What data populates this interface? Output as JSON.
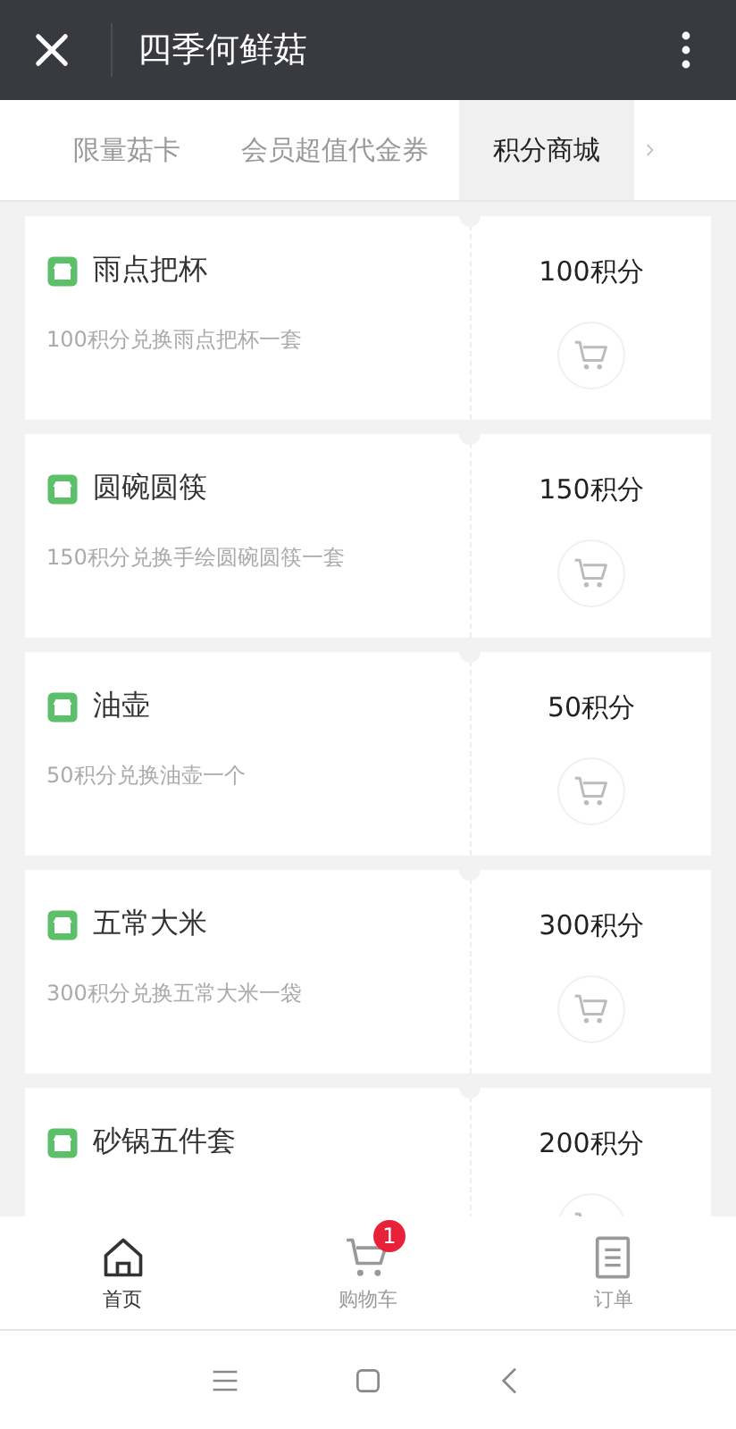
{
  "header": {
    "title": "四季何鲜菇"
  },
  "tabs": [
    {
      "label": "限量菇卡",
      "selected": false
    },
    {
      "label": "会员超值代金券",
      "selected": false
    },
    {
      "label": "积分商城",
      "selected": true
    }
  ],
  "products": [
    {
      "name": "雨点把杯",
      "description": "100积分兑换雨点把杯一套",
      "points": "100积分"
    },
    {
      "name": "圆碗圆筷",
      "description": "150积分兑换手绘圆碗圆筷一套",
      "points": "150积分"
    },
    {
      "name": "油壶",
      "description": "50积分兑换油壶一个",
      "points": "50积分"
    },
    {
      "name": "五常大米",
      "description": "300积分兑换五常大米一袋",
      "points": "300积分"
    },
    {
      "name": "砂锅五件套",
      "points": "200积分"
    }
  ],
  "bottom_nav": [
    {
      "kind": "home",
      "label": "首页",
      "selected": true
    },
    {
      "kind": "cart",
      "label": "购物车",
      "selected": false,
      "badge": "1"
    },
    {
      "kind": "orders",
      "label": "订单",
      "selected": false
    }
  ]
}
